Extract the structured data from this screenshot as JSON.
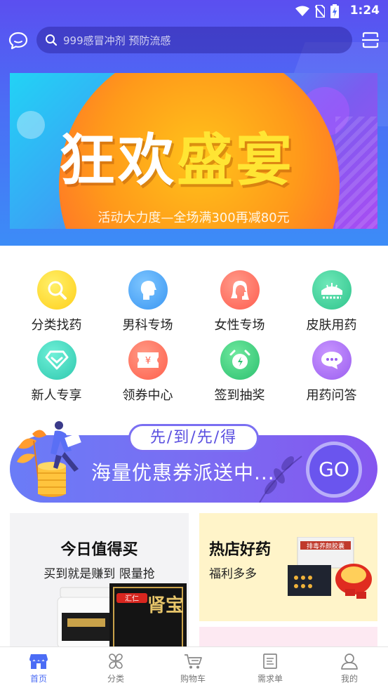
{
  "status_bar": {
    "time": "1:24"
  },
  "search": {
    "placeholder": "999感冒冲剂  预防流感"
  },
  "banner": {
    "title_white": "狂欢",
    "title_yellow": "盛宴",
    "subtitle": "活动大力度—全场满300再减80元"
  },
  "categories": [
    {
      "label": "分类找药",
      "icon": "search-pill-icon",
      "color": "#ffd21f"
    },
    {
      "label": "男科专场",
      "icon": "male-profile-icon",
      "color": "#49a6f5"
    },
    {
      "label": "女性专场",
      "icon": "female-profile-icon",
      "color": "#ff6f5e"
    },
    {
      "label": "皮肤用药",
      "icon": "skin-icon",
      "color": "#3ccf98"
    },
    {
      "label": "新人专享",
      "icon": "gift-diamond-icon",
      "color": "#3fd0b8"
    },
    {
      "label": "领券中心",
      "icon": "coupon-icon",
      "color": "#ff6a55"
    },
    {
      "label": "签到抽奖",
      "icon": "alarm-clock-icon",
      "color": "#33cc7e"
    },
    {
      "label": "用药问答",
      "icon": "chat-bubble-icon",
      "color": "#a86af2"
    }
  ],
  "coupon_banner": {
    "tab_text": "先/到/先/得",
    "text": "海量优惠券派送中...",
    "go_label": "GO"
  },
  "promo_left": {
    "title": "今日值得买",
    "subtitle": "买到就是赚到 限量抢",
    "box_brand": "汇仁",
    "box_text": "肾宝"
  },
  "promo_right": {
    "title": "热店好药",
    "subtitle": "福利多多",
    "product_text": "排毒养颜胶囊"
  },
  "nav": {
    "home": "首页",
    "category": "分类",
    "cart": "购物车",
    "demand": "需求单",
    "mine": "我的"
  },
  "colors": {
    "accent": "#4b6cf5",
    "header_top": "#5b4ff0",
    "header_bottom": "#3c8cf7"
  }
}
